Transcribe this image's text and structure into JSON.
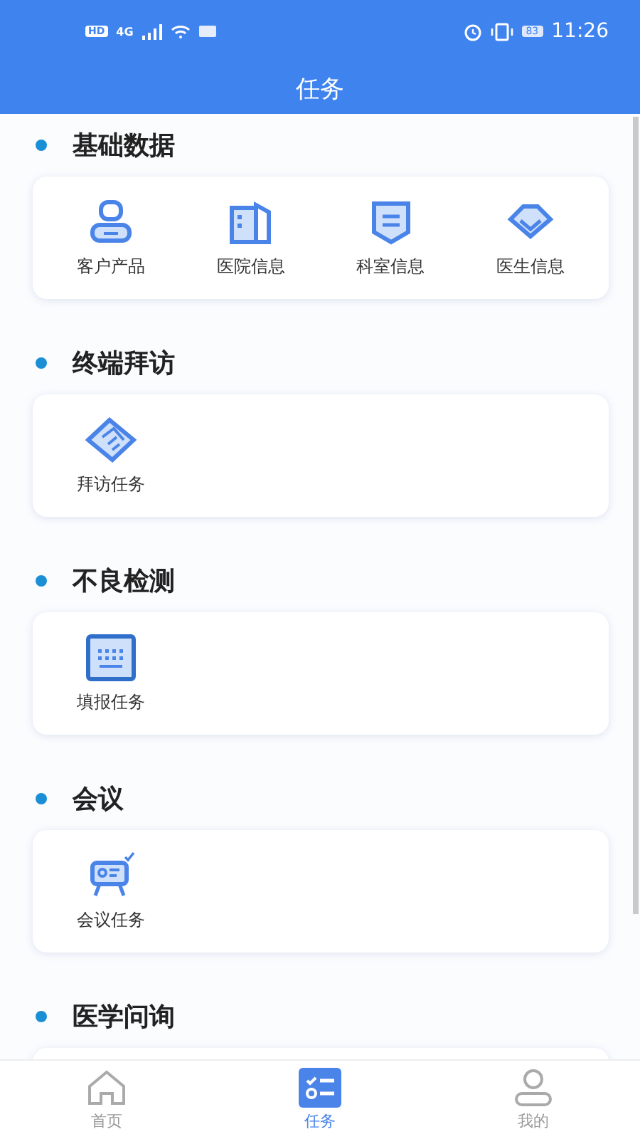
{
  "status_bar": {
    "badges": [
      "HD",
      "4G"
    ],
    "battery": "83",
    "time": "11:26"
  },
  "header": {
    "title": "任务"
  },
  "sections": [
    {
      "title": "基础数据",
      "items": [
        {
          "label": "客户产品"
        },
        {
          "label": "医院信息"
        },
        {
          "label": "科室信息"
        },
        {
          "label": "医生信息"
        }
      ]
    },
    {
      "title": "终端拜访",
      "items": [
        {
          "label": "拜访任务"
        }
      ]
    },
    {
      "title": "不良检测",
      "items": [
        {
          "label": "填报任务"
        }
      ]
    },
    {
      "title": "会议",
      "items": [
        {
          "label": "会议任务"
        }
      ]
    },
    {
      "title": "医学问询"
    }
  ],
  "tab_bar": [
    {
      "label": "首页",
      "selected": false
    },
    {
      "label": "任务",
      "selected": true
    },
    {
      "label": "我的",
      "selected": false
    }
  ]
}
